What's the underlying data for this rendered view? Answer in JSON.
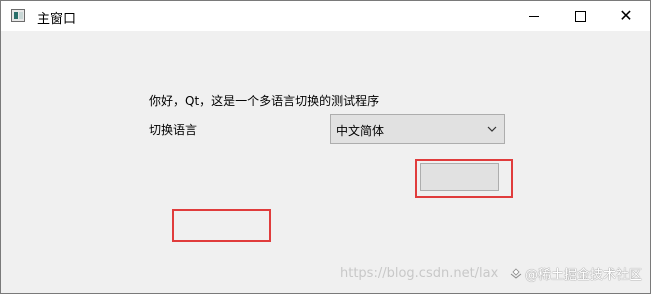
{
  "window": {
    "title": "主窗口",
    "controls": {
      "minimize": "minimize",
      "maximize": "maximize",
      "close": "✕"
    }
  },
  "main": {
    "greeting": "你好，Qt，这是一个多语言切换的测试程序",
    "language_label": "切换语言",
    "language_combo": {
      "selected": "中文简体"
    }
  },
  "highlights": {
    "color": "#e03c3c"
  },
  "watermark": {
    "url": "https://blog.csdn.net/lax",
    "brand": "@稀土掘金技术社区"
  }
}
